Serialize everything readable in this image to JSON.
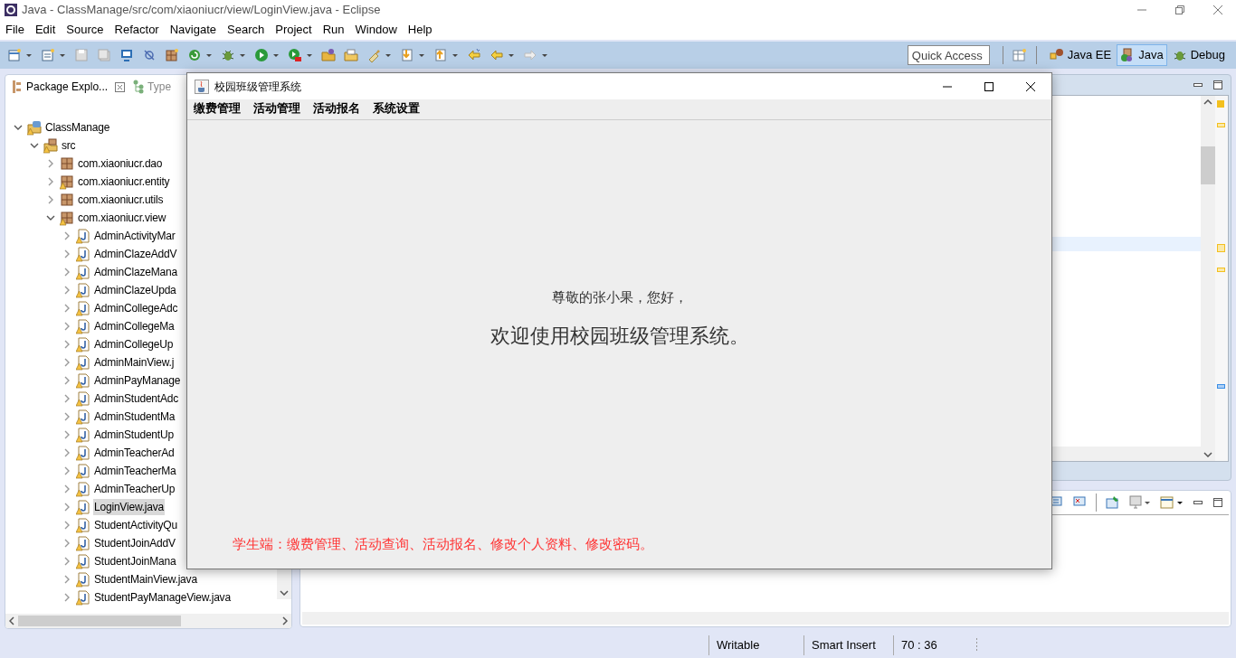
{
  "window": {
    "title": "Java - ClassManage/src/com/xiaoniucr/view/LoginView.java - Eclipse"
  },
  "menu": [
    "File",
    "Edit",
    "Source",
    "Refactor",
    "Navigate",
    "Search",
    "Project",
    "Run",
    "Window",
    "Help"
  ],
  "quick_access": {
    "placeholder": "Quick Access"
  },
  "perspectives": [
    {
      "label": "Java EE",
      "selected": false
    },
    {
      "label": "Java",
      "selected": true
    },
    {
      "label": "Debug",
      "selected": false
    }
  ],
  "view_tabs": [
    {
      "label": "Package Explo...",
      "selected": true
    },
    {
      "label": "Type",
      "selected": false
    }
  ],
  "tree": [
    {
      "label": "ClassManage",
      "kind": "project",
      "warning": true,
      "expanded": true,
      "selected": false,
      "children": [
        {
          "label": "src",
          "kind": "folder",
          "warning": true,
          "expanded": true,
          "selected": false,
          "children": [
            {
              "label": "com.xiaoniucr.dao",
              "kind": "package",
              "warning": false,
              "expanded": false,
              "selected": false
            },
            {
              "label": "com.xiaoniucr.entity",
              "kind": "package",
              "warning": true,
              "expanded": false,
              "selected": false
            },
            {
              "label": "com.xiaoniucr.utils",
              "kind": "package",
              "warning": false,
              "expanded": false,
              "selected": false
            },
            {
              "label": "com.xiaoniucr.view",
              "kind": "package",
              "warning": true,
              "expanded": true,
              "selected": false,
              "children": [
                {
                  "label": "AdminActivityMar",
                  "kind": "file",
                  "warning": true,
                  "expanded": false,
                  "selected": false
                },
                {
                  "label": "AdminClazeAddV",
                  "kind": "file",
                  "warning": true,
                  "expanded": false,
                  "selected": false
                },
                {
                  "label": "AdminClazeMana",
                  "kind": "file",
                  "warning": true,
                  "expanded": false,
                  "selected": false
                },
                {
                  "label": "AdminClazeUpda",
                  "kind": "file",
                  "warning": true,
                  "expanded": false,
                  "selected": false
                },
                {
                  "label": "AdminCollegeAdc",
                  "kind": "file",
                  "warning": true,
                  "expanded": false,
                  "selected": false
                },
                {
                  "label": "AdminCollegeMa",
                  "kind": "file",
                  "warning": true,
                  "expanded": false,
                  "selected": false
                },
                {
                  "label": "AdminCollegeUp",
                  "kind": "file",
                  "warning": true,
                  "expanded": false,
                  "selected": false
                },
                {
                  "label": "AdminMainView.j",
                  "kind": "file",
                  "warning": true,
                  "expanded": false,
                  "selected": false
                },
                {
                  "label": "AdminPayManage",
                  "kind": "file",
                  "warning": true,
                  "expanded": false,
                  "selected": false
                },
                {
                  "label": "AdminStudentAdc",
                  "kind": "file",
                  "warning": true,
                  "expanded": false,
                  "selected": false
                },
                {
                  "label": "AdminStudentMa",
                  "kind": "file",
                  "warning": true,
                  "expanded": false,
                  "selected": false
                },
                {
                  "label": "AdminStudentUp",
                  "kind": "file",
                  "warning": true,
                  "expanded": false,
                  "selected": false
                },
                {
                  "label": "AdminTeacherAd",
                  "kind": "file",
                  "warning": true,
                  "expanded": false,
                  "selected": false
                },
                {
                  "label": "AdminTeacherMa",
                  "kind": "file",
                  "warning": true,
                  "expanded": false,
                  "selected": false
                },
                {
                  "label": "AdminTeacherUp",
                  "kind": "file",
                  "warning": true,
                  "expanded": false,
                  "selected": false
                },
                {
                  "label": "LoginView.java",
                  "kind": "file",
                  "warning": true,
                  "expanded": false,
                  "selected": true
                },
                {
                  "label": "StudentActivityQu",
                  "kind": "file",
                  "warning": true,
                  "expanded": false,
                  "selected": false
                },
                {
                  "label": "StudentJoinAddV",
                  "kind": "file",
                  "warning": true,
                  "expanded": false,
                  "selected": false
                },
                {
                  "label": "StudentJoinMana",
                  "kind": "file",
                  "warning": true,
                  "expanded": false,
                  "selected": false
                },
                {
                  "label": "StudentMainView.java",
                  "kind": "file",
                  "warning": true,
                  "expanded": false,
                  "selected": false
                },
                {
                  "label": "StudentPayManageView.java",
                  "kind": "file",
                  "warning": true,
                  "expanded": false,
                  "selected": false
                }
              ]
            }
          ]
        }
      ]
    }
  ],
  "status_bar": [
    "Writable",
    "Smart Insert",
    "70 : 36"
  ],
  "app": {
    "title": "校园班级管理系统",
    "menu": [
      "缴费管理",
      "活动管理",
      "活动报名",
      "系统设置"
    ],
    "greeting": "尊敬的张小果，您好，",
    "headline": "欢迎使用校园班级管理系统。",
    "note": "学生端：缴费管理、活动查询、活动报名、修改个人资料、修改密码。"
  }
}
